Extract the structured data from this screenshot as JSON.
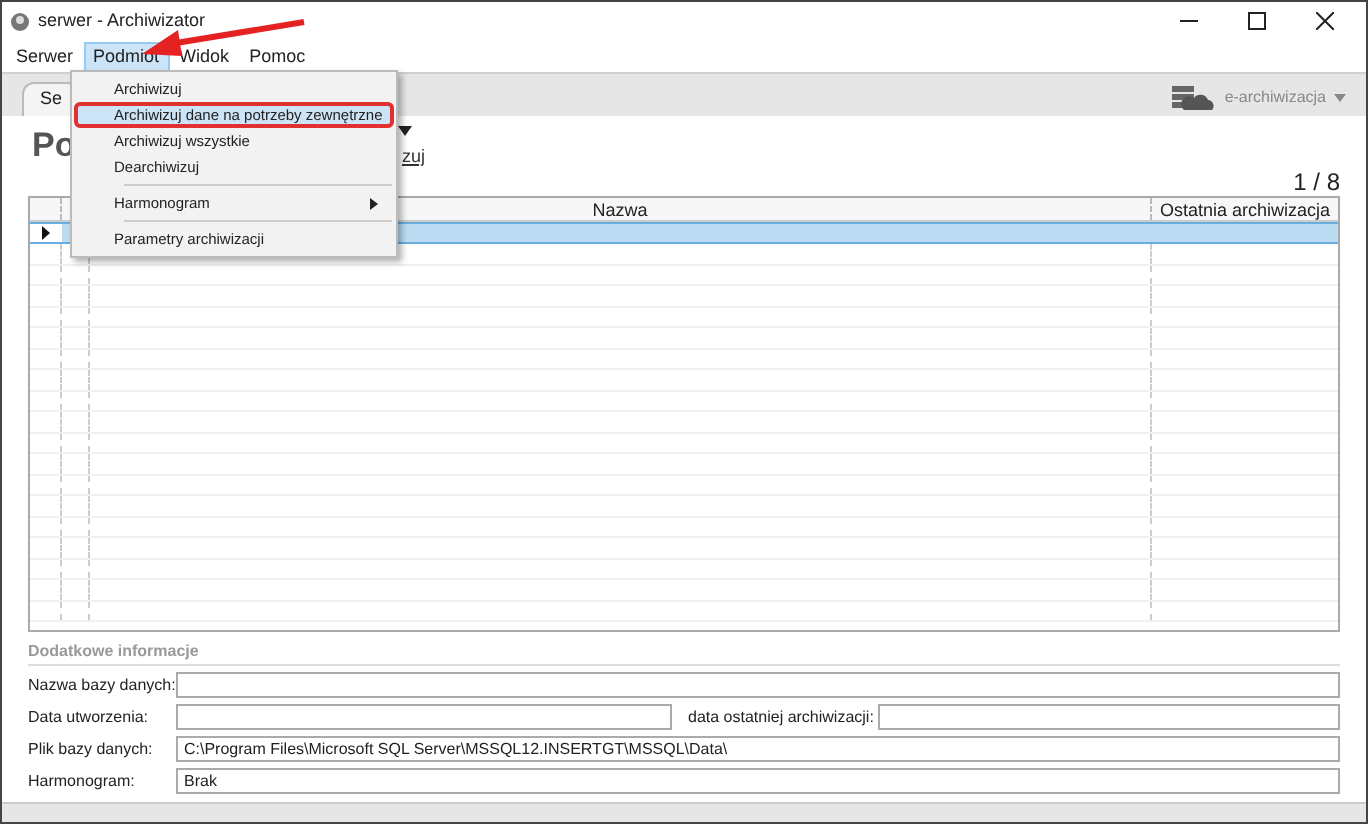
{
  "window": {
    "title": "serwer - Archiwizator"
  },
  "menu_bar": [
    {
      "label": "Serwer",
      "selected": false
    },
    {
      "label": "Podmiot",
      "selected": true
    },
    {
      "label": "Widok",
      "selected": false
    },
    {
      "label": "Pomoc",
      "selected": false
    }
  ],
  "dropdown": [
    {
      "label": "Archiwizuj",
      "kind": "item",
      "selected": false,
      "separator_before": false
    },
    {
      "label": "Archiwizuj dane na potrzeby zewnętrzne",
      "kind": "item",
      "selected": true,
      "separator_before": false
    },
    {
      "label": "Archiwizuj wszystkie",
      "kind": "item",
      "selected": false,
      "separator_before": false
    },
    {
      "label": "Dearchiwizuj",
      "kind": "item",
      "selected": false,
      "separator_before": false
    },
    {
      "label": "Harmonogram",
      "kind": "submenu",
      "selected": false,
      "separator_before": true
    },
    {
      "label": "Parametry archiwizacji",
      "kind": "item",
      "selected": false,
      "separator_before": true
    }
  ],
  "tab": {
    "label": "Se"
  },
  "toolbar": {
    "button": "e-archiwizacja"
  },
  "heading": "Po",
  "link": "zuj",
  "counter": "1 / 8",
  "table": {
    "columns": [
      "Nazwa",
      "Ostatnia archiwizacja"
    ],
    "rows": [
      {
        "selected": true
      }
    ]
  },
  "details": {
    "title": "Dodatkowe informacje",
    "fields": [
      {
        "label": "Nazwa bazy danych:"
      },
      {
        "label": "Data utworzenia:",
        "side_label": "data ostatniej archiwizacji:"
      },
      {
        "label": "Plik bazy danych:",
        "value": "C:\\Program Files\\Microsoft SQL Server\\MSSQL12.INSERTGT\\MSSQL\\Data\\"
      },
      {
        "label": "Harmonogram:",
        "value": "Brak"
      }
    ]
  }
}
